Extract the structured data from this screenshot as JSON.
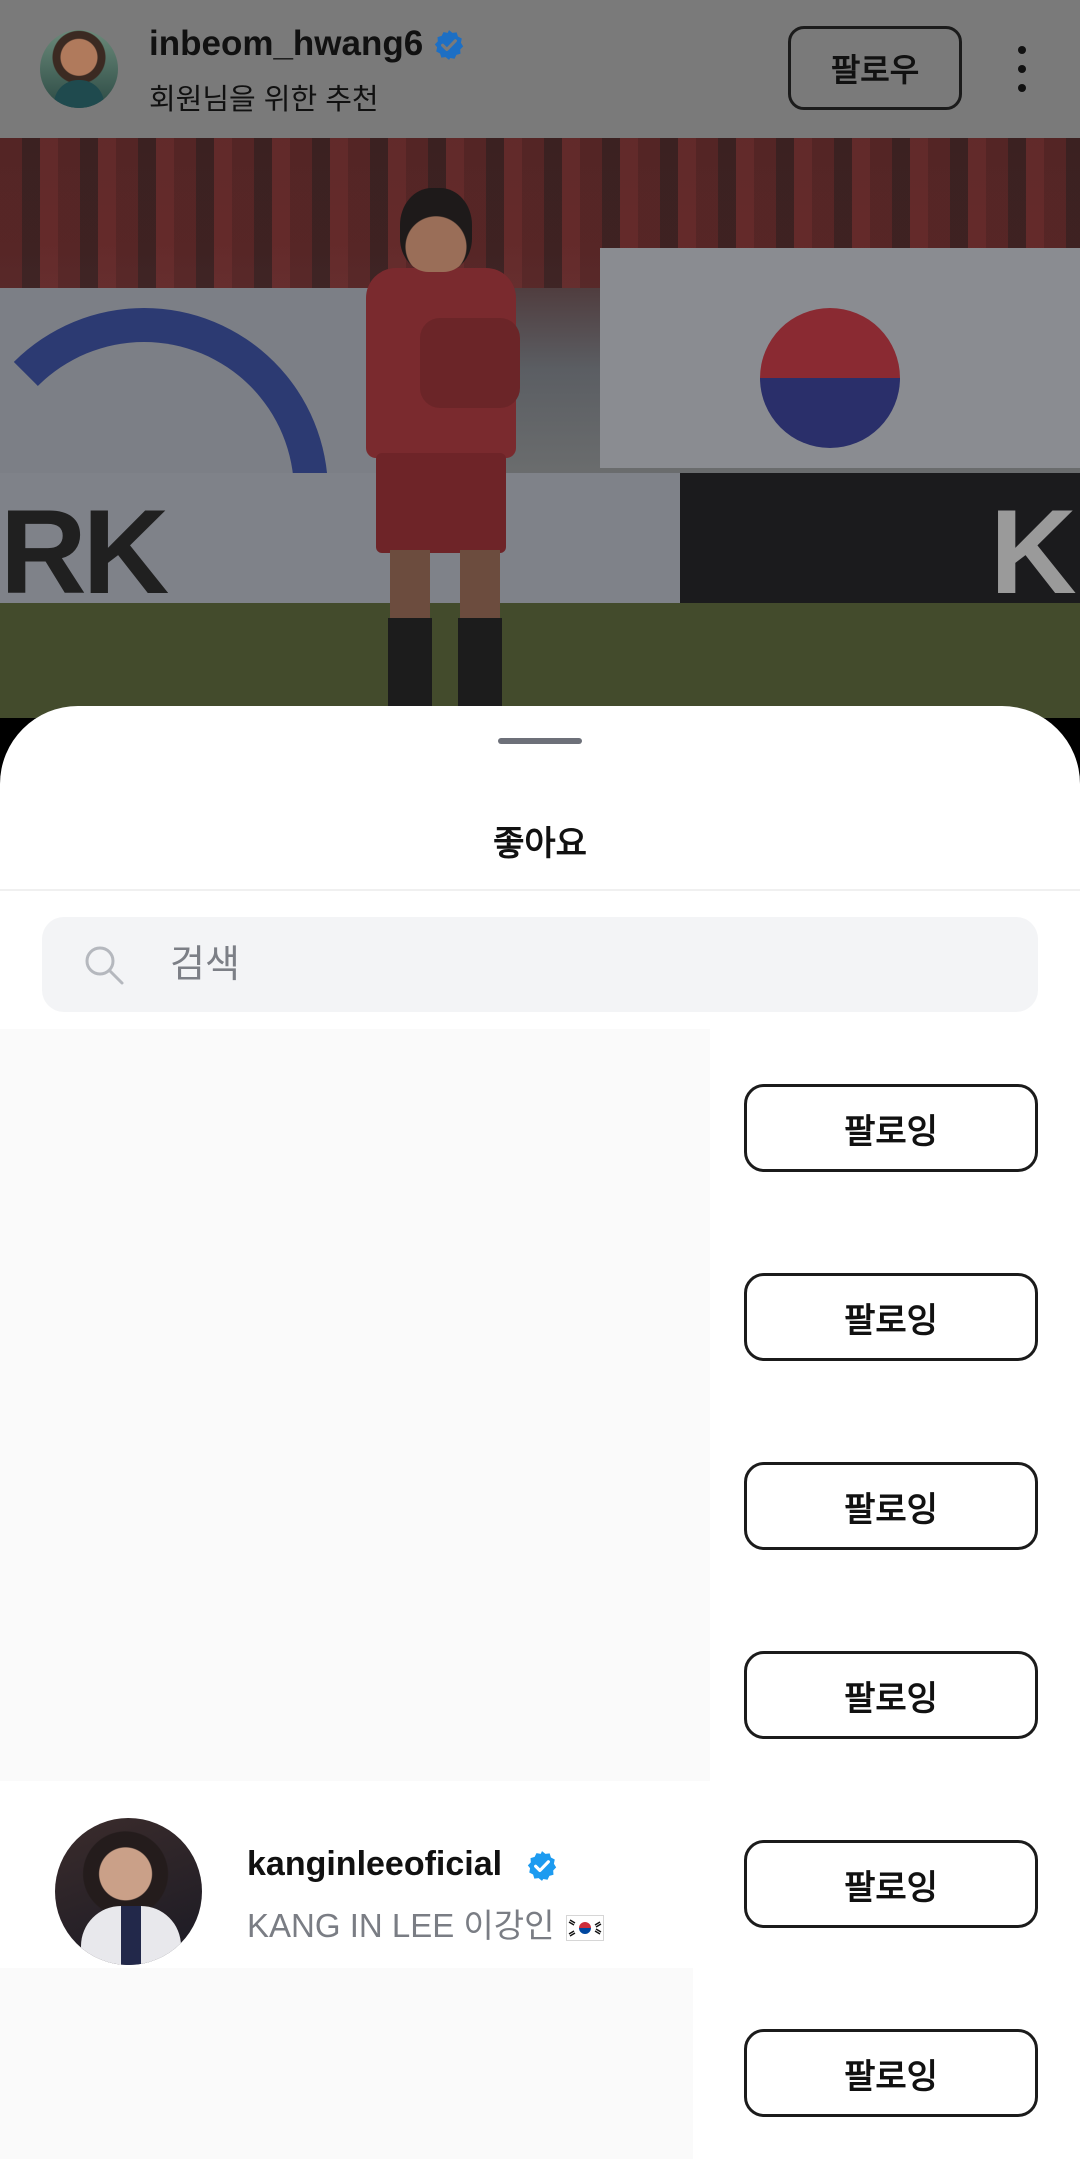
{
  "post": {
    "username": "inbeom_hwang6",
    "subtitle": "회원님을 위한 추천",
    "follow_label": "팔로우",
    "board_text_left": "RK",
    "board_text_right": "K"
  },
  "sheet": {
    "title": "좋아요",
    "search": {
      "placeholder": "검색"
    },
    "rows": [
      {
        "button_label": "팔로잉"
      },
      {
        "button_label": "팔로잉"
      },
      {
        "button_label": "팔로잉"
      },
      {
        "button_label": "팔로잉"
      },
      {
        "username": "kanginleeoficial",
        "fullname": "KANG IN LEE 이강인",
        "verified": true,
        "button_label": "팔로잉"
      },
      {
        "button_label": "팔로잉"
      }
    ]
  },
  "colors": {
    "verified_blue": "#1d9bf0",
    "button_border": "#1b1b1b",
    "secondary_text": "#7a7d84",
    "search_bg": "#f3f4f6"
  }
}
